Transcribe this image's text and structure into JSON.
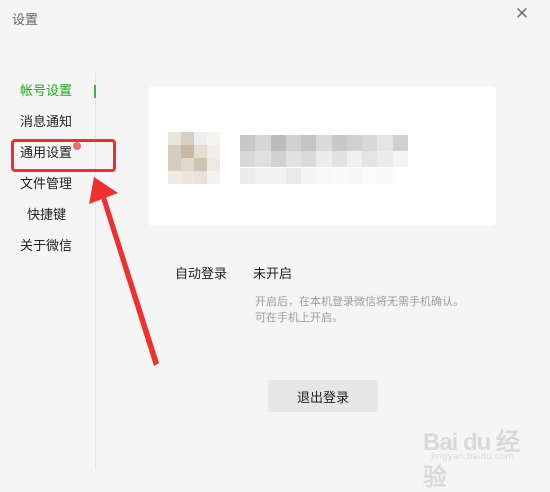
{
  "window": {
    "title": "设置",
    "close_icon": "close-icon"
  },
  "sidebar": {
    "items": [
      {
        "label": "帐号设置",
        "active": true
      },
      {
        "label": "消息通知",
        "active": false
      },
      {
        "label": "通用设置",
        "active": false,
        "badge": true
      },
      {
        "label": "文件管理",
        "active": false
      },
      {
        "label": "快捷键",
        "active": false
      },
      {
        "label": "关于微信",
        "active": false
      }
    ]
  },
  "account": {
    "auto_login_label": "自动登录",
    "auto_login_value": "未开启",
    "hint_line1": "开启后，在本机登录微信将无需手机确认。",
    "hint_line2": "可在手机上开启。",
    "logout_button": "退出登录"
  },
  "watermark": {
    "main": "Bai du 经验",
    "sub": "jingyan.baidu.com"
  },
  "colors": {
    "active": "#1aad19",
    "annotation": "#f0302e",
    "badge": "#f26d6d"
  }
}
